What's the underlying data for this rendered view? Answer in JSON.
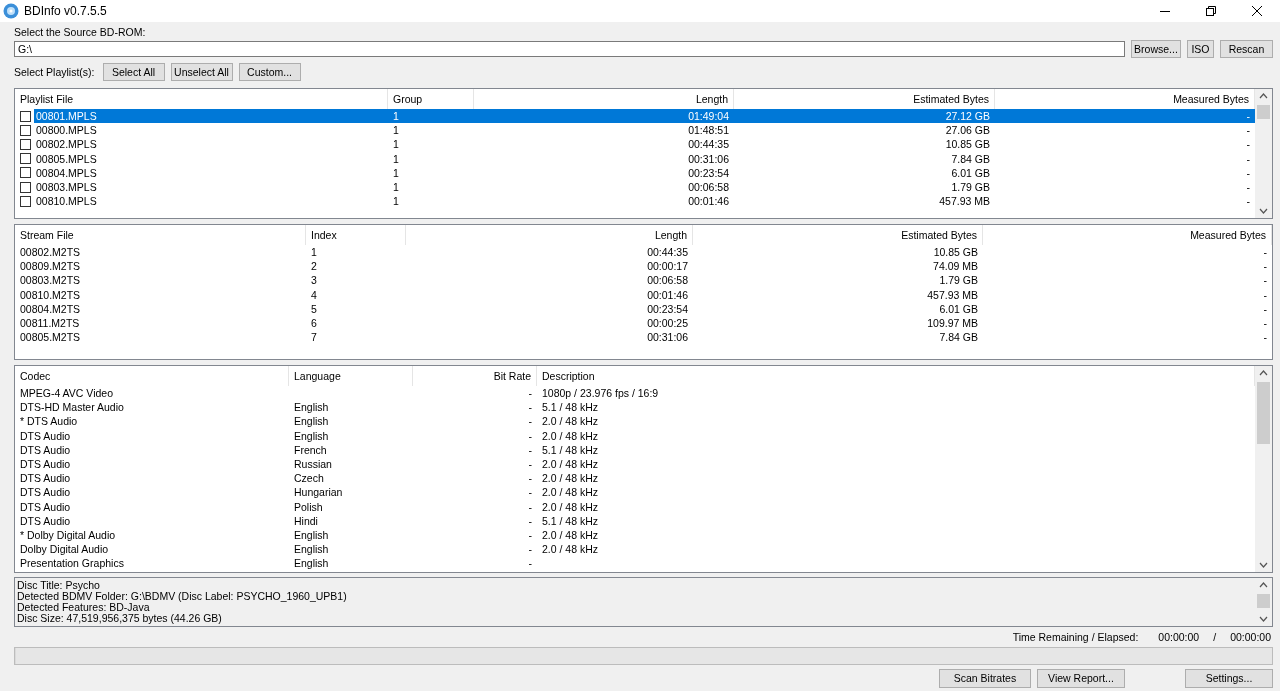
{
  "window": {
    "title": "BDInfo v0.7.5.5"
  },
  "source": {
    "label": "Select the Source BD-ROM:",
    "value": "G:\\",
    "buttons": [
      "Browse...",
      "ISO",
      "Rescan"
    ]
  },
  "playlist_select": {
    "label": "Select Playlist(s):",
    "buttons": [
      "Select All",
      "Unselect All",
      "Custom..."
    ]
  },
  "playlists": {
    "columns": [
      "Playlist File",
      "Group",
      "Length",
      "Estimated Bytes",
      "Measured Bytes"
    ],
    "rows": [
      {
        "cells": [
          "00801.MPLS",
          "1",
          "01:49:04",
          "27.12 GB",
          "-"
        ],
        "checked": false,
        "selected": true
      },
      {
        "cells": [
          "00800.MPLS",
          "1",
          "01:48:51",
          "27.06 GB",
          "-"
        ],
        "checked": false,
        "selected": false
      },
      {
        "cells": [
          "00802.MPLS",
          "1",
          "00:44:35",
          "10.85 GB",
          "-"
        ],
        "checked": false,
        "selected": false
      },
      {
        "cells": [
          "00805.MPLS",
          "1",
          "00:31:06",
          "7.84 GB",
          "-"
        ],
        "checked": false,
        "selected": false
      },
      {
        "cells": [
          "00804.MPLS",
          "1",
          "00:23:54",
          "6.01 GB",
          "-"
        ],
        "checked": false,
        "selected": false
      },
      {
        "cells": [
          "00803.MPLS",
          "1",
          "00:06:58",
          "1.79 GB",
          "-"
        ],
        "checked": false,
        "selected": false
      },
      {
        "cells": [
          "00810.MPLS",
          "1",
          "00:01:46",
          "457.93 MB",
          "-"
        ],
        "checked": false,
        "selected": false
      }
    ]
  },
  "streams": {
    "columns": [
      "Stream File",
      "Index",
      "Length",
      "Estimated Bytes",
      "Measured Bytes"
    ],
    "rows": [
      [
        "00802.M2TS",
        "1",
        "00:44:35",
        "10.85 GB",
        "-"
      ],
      [
        "00809.M2TS",
        "2",
        "00:00:17",
        "74.09 MB",
        "-"
      ],
      [
        "00803.M2TS",
        "3",
        "00:06:58",
        "1.79 GB",
        "-"
      ],
      [
        "00810.M2TS",
        "4",
        "00:01:46",
        "457.93 MB",
        "-"
      ],
      [
        "00804.M2TS",
        "5",
        "00:23:54",
        "6.01 GB",
        "-"
      ],
      [
        "00811.M2TS",
        "6",
        "00:00:25",
        "109.97 MB",
        "-"
      ],
      [
        "00805.M2TS",
        "7",
        "00:31:06",
        "7.84 GB",
        "-"
      ]
    ]
  },
  "codecs": {
    "columns": [
      "Codec",
      "Language",
      "Bit Rate",
      "Description"
    ],
    "rows": [
      [
        "MPEG-4 AVC Video",
        "",
        "-",
        "1080p / 23.976 fps / 16:9"
      ],
      [
        "DTS-HD Master Audio",
        "English",
        "-",
        "5.1 / 48 kHz"
      ],
      [
        "* DTS Audio",
        "English",
        "-",
        "2.0 / 48 kHz"
      ],
      [
        "DTS Audio",
        "English",
        "-",
        "2.0 / 48 kHz"
      ],
      [
        "DTS Audio",
        "French",
        "-",
        "5.1 / 48 kHz"
      ],
      [
        "DTS Audio",
        "Russian",
        "-",
        "2.0 / 48 kHz"
      ],
      [
        "DTS Audio",
        "Czech",
        "-",
        "2.0 / 48 kHz"
      ],
      [
        "DTS Audio",
        "Hungarian",
        "-",
        "2.0 / 48 kHz"
      ],
      [
        "DTS Audio",
        "Polish",
        "-",
        "2.0 / 48 kHz"
      ],
      [
        "DTS Audio",
        "Hindi",
        "-",
        "5.1 / 48 kHz"
      ],
      [
        "* Dolby Digital Audio",
        "English",
        "-",
        "2.0 / 48 kHz"
      ],
      [
        "Dolby Digital Audio",
        "English",
        "-",
        "2.0 / 48 kHz"
      ],
      [
        "Presentation Graphics",
        "English",
        "-",
        ""
      ]
    ]
  },
  "info": [
    "Disc Title: Psycho",
    "Detected BDMV Folder: G:\\BDMV (Disc Label: PSYCHO_1960_UPB1)",
    "Detected Features: BD-Java",
    "Disc Size: 47,519,956,375 bytes (44.26 GB)"
  ],
  "progress": {
    "level": 0
  },
  "time": {
    "label": "Time Remaining / Elapsed:",
    "remaining": "00:00:00",
    "separator": "/",
    "elapsed": "00:00:00"
  },
  "bottom_buttons": [
    "Scan Bitrates",
    "View Report...",
    "Settings..."
  ]
}
